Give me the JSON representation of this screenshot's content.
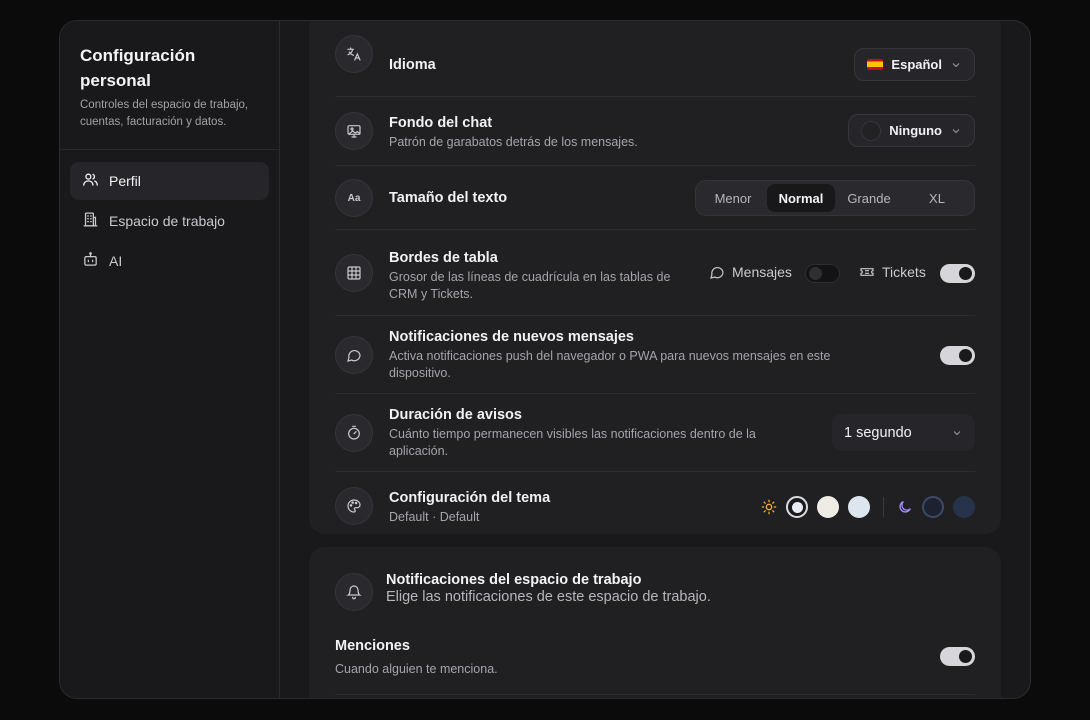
{
  "sidebar": {
    "title": "Configuración personal",
    "description": "Controles del espacio de trabajo, cuentas, facturación y datos.",
    "items": [
      {
        "label": "Perfil",
        "icon": "users-icon",
        "active": true
      },
      {
        "label": "Espacio de trabajo",
        "icon": "building-icon",
        "active": false
      },
      {
        "label": "AI",
        "icon": "bot-icon",
        "active": false
      }
    ]
  },
  "settings": {
    "language": {
      "title": "Idioma",
      "value": "Español"
    },
    "chat_background": {
      "title": "Fondo del chat",
      "desc": "Patrón de garabatos detrás de los mensajes.",
      "value": "Ninguno"
    },
    "text_size": {
      "title": "Tamaño del texto",
      "options": [
        "Menor",
        "Normal",
        "Grande",
        "XL"
      ],
      "selected": "Normal"
    },
    "table_borders": {
      "title": "Bordes de tabla",
      "desc": "Grosor de las líneas de cuadrícula en las tablas de CRM y Tickets.",
      "messages_label": "Mensajes",
      "tickets_label": "Tickets"
    },
    "new_message_notifications": {
      "title": "Notificaciones de nuevos mensajes",
      "desc": "Activa notificaciones push del navegador o PWA para nuevos mensajes en este dispositivo."
    },
    "toast_duration": {
      "title": "Duración de avisos",
      "desc": "Cuánto tiempo permanecen visibles las notificaciones dentro de la aplicación.",
      "value": "1 segundo"
    },
    "theme": {
      "title": "Configuración del tema",
      "desc": "Default · Default",
      "light_colors": [
        "#e8edf5",
        "#efece6",
        "#dde6ef"
      ],
      "dark_colors": [
        "#1c2230",
        "#26334a"
      ]
    }
  },
  "workspace_notifications": {
    "title": "Notificaciones del espacio de trabajo",
    "desc": "Elige las notificaciones de este espacio de trabajo.",
    "mentions": {
      "title": "Menciones",
      "desc": "Cuando alguien te menciona."
    }
  }
}
